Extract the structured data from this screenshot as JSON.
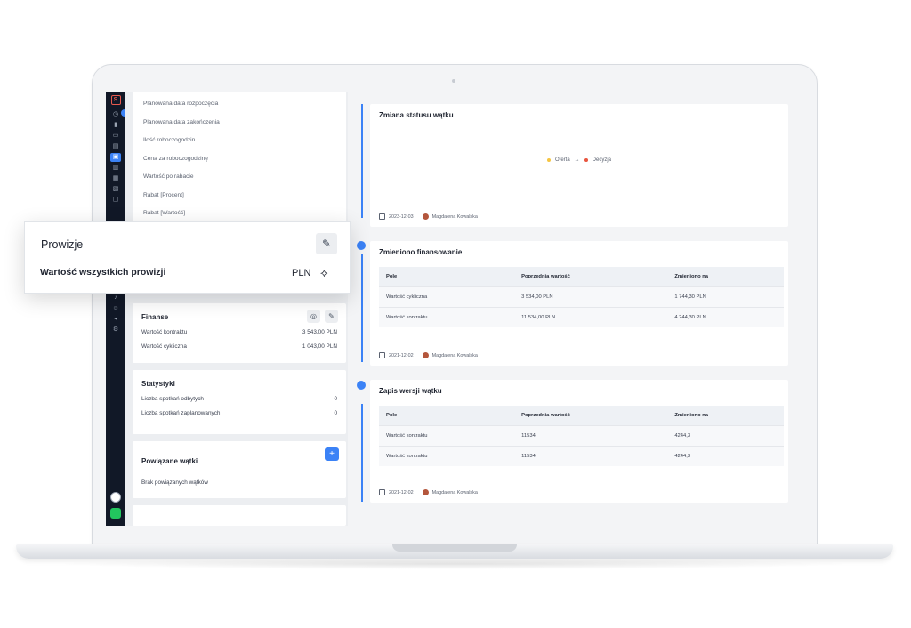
{
  "left_fields": [
    "Planowana data rozpoczęcia",
    "Planowana data zakończenia",
    "Ilość roboczogodzin",
    "Cena za roboczogodzinę",
    "Wartość po rabacie",
    "Rabat [Procent]",
    "Rabat [Wartość]"
  ],
  "popup": {
    "title": "Prowizje",
    "label": "Wartość wszystkich prowizji",
    "currency": "PLN",
    "edit_icon": "pencil-icon",
    "money_icon": "money-tag-icon"
  },
  "finanse": {
    "title": "Finanse",
    "rows": [
      {
        "label": "Wartość kontraktu",
        "value": "3 543,00 PLN"
      },
      {
        "label": "Wartość cykliczna",
        "value": "1 043,00 PLN"
      }
    ]
  },
  "statystyki": {
    "title": "Statystyki",
    "rows": [
      {
        "label": "Liczba spotkań odbytych",
        "value": "0"
      },
      {
        "label": "Liczba spotkań zaplanowanych",
        "value": "0"
      }
    ]
  },
  "powiazane": {
    "title": "Powiązane wątki",
    "empty": "Brak powiązanych wątków",
    "add": "+"
  },
  "events": [
    {
      "title": "Zmiana statusu wątku",
      "status_from": "Oferta",
      "status_to": "Decyzja",
      "date": "2023-12-03",
      "user": "Magdalena Kowalska"
    },
    {
      "title": "Zmieniono finansowanie",
      "headers": [
        "Pole",
        "Poprzednia wartość",
        "Zmieniono na"
      ],
      "rows": [
        [
          "Wartość cykliczna",
          "3 534,00 PLN",
          "1 744,30 PLN"
        ],
        [
          "Wartość kontraktu",
          "11 534,00 PLN",
          "4 244,30 PLN"
        ]
      ],
      "date": "2021-12-02",
      "user": "Magdalena Kowalska"
    },
    {
      "title": "Zapis wersji wątku",
      "headers": [
        "Pole",
        "Poprzednia wartość",
        "Zmieniono na"
      ],
      "rows": [
        [
          "Wartość kontraktu",
          "11534",
          "4244,3"
        ],
        [
          "Wartość kontraktu",
          "11534",
          "4244,3"
        ]
      ],
      "date": "2021-12-02",
      "user": "Magdalena Kowalska"
    }
  ],
  "colors": {
    "accent": "#3b82f6",
    "sidebar": "#111827",
    "status_from": "#f5c542",
    "status_to": "#e8553f"
  }
}
